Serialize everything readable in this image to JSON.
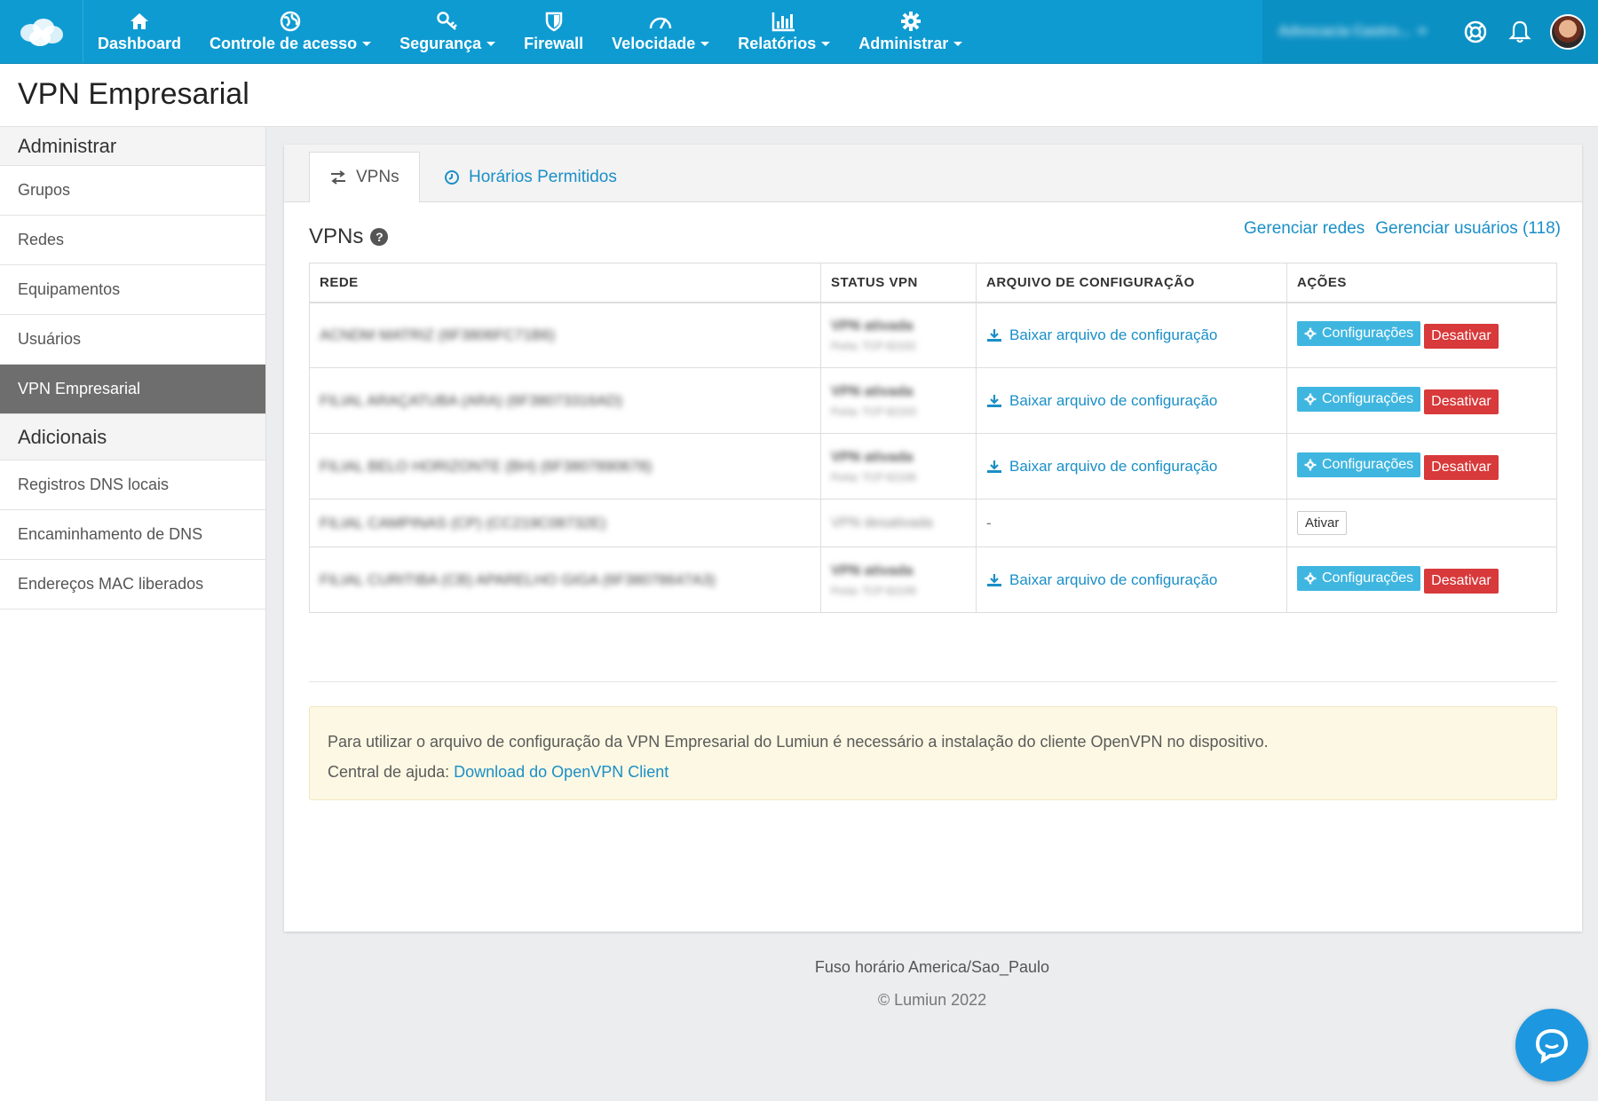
{
  "nav": {
    "items": [
      {
        "label": "Dashboard",
        "icon": "home-icon",
        "caret": false
      },
      {
        "label": "Controle de acesso",
        "icon": "globe-icon",
        "caret": true
      },
      {
        "label": "Segurança",
        "icon": "key-icon",
        "caret": true
      },
      {
        "label": "Firewall",
        "icon": "shield-icon",
        "caret": false
      },
      {
        "label": "Velocidade",
        "icon": "speedometer-icon",
        "caret": true
      },
      {
        "label": "Relatórios",
        "icon": "bar-chart-icon",
        "caret": true
      },
      {
        "label": "Administrar",
        "icon": "gear-icon",
        "caret": true
      }
    ],
    "account": "Advocacia Castro..."
  },
  "page": {
    "title": "VPN Empresarial"
  },
  "sidebar": {
    "section1": "Administrar",
    "items1": [
      "Grupos",
      "Redes",
      "Equipamentos",
      "Usuários",
      "VPN Empresarial"
    ],
    "section2": "Adicionais",
    "items2": [
      "Registros DNS locais",
      "Encaminhamento de DNS",
      "Endereços MAC liberados"
    ]
  },
  "tabs": {
    "vpns": "VPNs",
    "horarios": "Horários Permitidos"
  },
  "vpn": {
    "heading": "VPNs",
    "link_redes": "Gerenciar redes",
    "link_usuarios": "Gerenciar usuários (118)",
    "columns": [
      "REDE",
      "STATUS VPN",
      "ARQUIVO DE CONFIGURAÇÃO",
      "AÇÕES"
    ],
    "rows": [
      {
        "rede": "ACNDM MATRIZ (6F3806FC71B6)",
        "status": "VPN ativada",
        "porta": "Porta: TCP 62102",
        "active": true
      },
      {
        "rede": "FILIAL ARAÇATUBA (ARA) (6F38073316AD)",
        "status": "VPN ativada",
        "porta": "Porta: TCP 62103",
        "active": true
      },
      {
        "rede": "FILIAL BELO HORIZONTE (BH) (6F3807890678)",
        "status": "VPN ativada",
        "porta": "Porta: TCP 62108",
        "active": true
      },
      {
        "rede": "FILIAL CAMPINAS (CP) (CC219C08732E)",
        "status": "VPN desativada",
        "porta": "",
        "active": false
      },
      {
        "rede": "FILIAL CURITIBA (CB) APARELHO GIGA (6F38078647A3)",
        "status": "VPN ativada",
        "porta": "Porta: TCP 62109",
        "active": true
      }
    ],
    "download_label": "Baixar arquivo de configuração",
    "dash": "-",
    "btn_config": "Configurações",
    "btn_disable": "Desativar",
    "btn_enable": "Ativar"
  },
  "alert": {
    "line1": "Para utilizar o arquivo de configuração da VPN Empresarial do Lumiun é necessário a instalação do cliente OpenVPN no dispositivo.",
    "line2_prefix": "Central de ajuda:",
    "line2_link": "Download do OpenVPN Client"
  },
  "footer": {
    "timezone": "Fuso horário America/Sao_Paulo",
    "copyright": "© Lumiun 2022"
  },
  "colors": {
    "primary": "#0e9bd2",
    "info": "#3fb6e0",
    "danger": "#d8393a",
    "link": "#1a8fc7",
    "active_side": "#6e6e6e"
  }
}
